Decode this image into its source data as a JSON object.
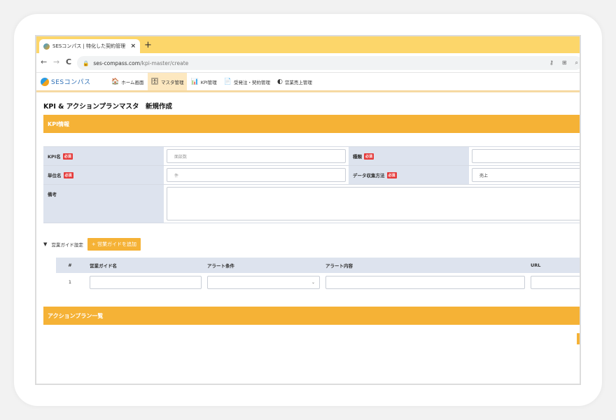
{
  "browser": {
    "tab_title": "SESコンパス | 特化した契約管理・案",
    "tab_close": "×",
    "new_tab": "+",
    "back": "←",
    "forward": "→",
    "reload": "C",
    "url_host": "ses-compass.com",
    "url_path": "/kpi-master/create"
  },
  "app": {
    "logo_text": "SESコンパス",
    "menu": [
      {
        "icon": "🏠",
        "label": "ホーム画面"
      },
      {
        "icon": "🗄",
        "label": "マスタ管理"
      },
      {
        "icon": "📊",
        "label": "KPI管理"
      },
      {
        "icon": "📄",
        "label": "受発注・契約管理"
      },
      {
        "icon": "◐",
        "label": "営業売上管理"
      }
    ]
  },
  "page": {
    "title": "KPI & アクションプランマスタ　新規作成",
    "section_kpi": "KPI情報",
    "section_action": "アクションプラン一覧"
  },
  "form": {
    "required_badge": "必須",
    "kpi_name_label": "KPI名",
    "kpi_name_placeholder": "面談数",
    "type_label": "種類",
    "type_value": "",
    "unit_label": "単位名",
    "unit_placeholder": "件",
    "collect_label": "データ収集方法",
    "collect_value": "売上",
    "note_label": "備考"
  },
  "guide": {
    "toggle": "▼",
    "label": "営業ガイド設定",
    "add_button": "+ 営業ガイドを追加",
    "headers": [
      "#",
      "営業ガイド名",
      "アラート条件",
      "アラート内容",
      "URL"
    ],
    "rows": [
      {
        "no": "1",
        "select_arrow": "⌄"
      }
    ]
  }
}
